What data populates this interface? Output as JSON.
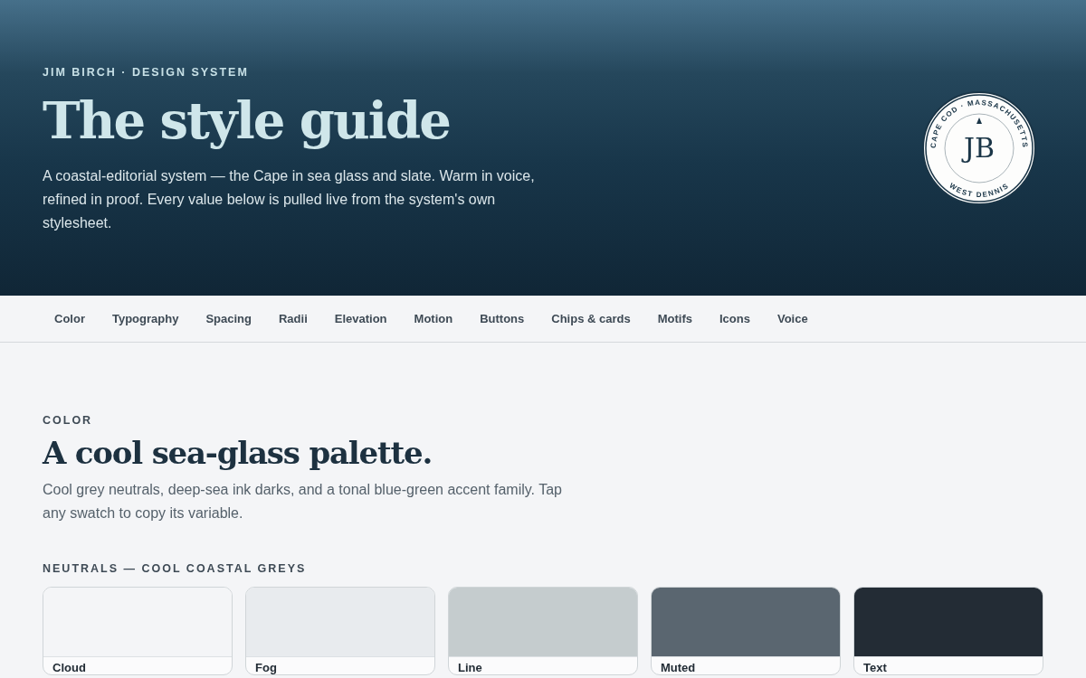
{
  "hero": {
    "eyebrow": "JIM BIRCH · DESIGN SYSTEM",
    "title": "The style guide",
    "lede": "A coastal-editorial system — the Cape in sea glass and slate. Warm in voice, refined in proof. Every value below is pulled live from the system's own stylesheet.",
    "seal": {
      "top": "CAPE COD · MASSACHUSETTS",
      "monogram": "JB",
      "bottom": "WEST DENNIS"
    }
  },
  "nav": [
    "Color",
    "Typography",
    "Spacing",
    "Radii",
    "Elevation",
    "Motion",
    "Buttons",
    "Chips & cards",
    "Motifs",
    "Icons",
    "Voice"
  ],
  "section": {
    "eyebrow": "COLOR",
    "title": "A cool sea-glass palette.",
    "lede": "Cool grey neutrals, deep-sea ink darks, and a tonal blue-green accent family. Tap any swatch to copy its variable.",
    "group": "NEUTRALS — COOL COASTAL GREYS",
    "swatches": [
      {
        "name": "Cloud",
        "color": "#f4f5f7"
      },
      {
        "name": "Fog",
        "color": "#e8ebee"
      },
      {
        "name": "Line",
        "color": "#c5ccce"
      },
      {
        "name": "Muted",
        "color": "#5a6670"
      },
      {
        "name": "Text",
        "color": "#232c35"
      }
    ]
  }
}
